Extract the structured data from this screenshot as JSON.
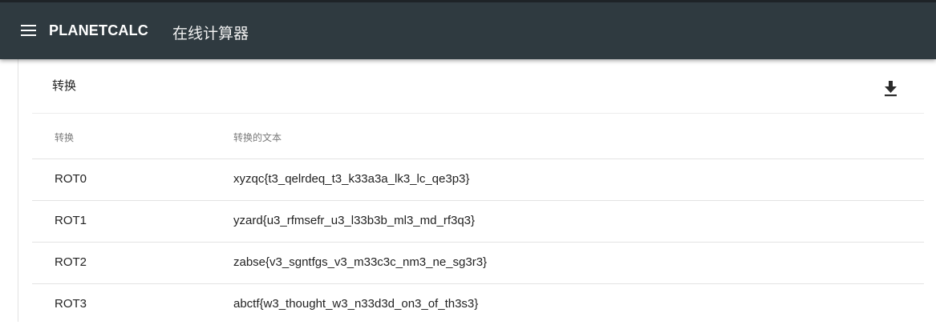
{
  "header": {
    "brand": "PLANETCALC",
    "subtitle": "在线计算器"
  },
  "card": {
    "title": "转换",
    "columns": {
      "transform": "转换",
      "transformed_text": "转换的文本"
    },
    "rows": [
      {
        "name": "ROT0",
        "text": "xyzqc{t3_qelrdeq_t3_k33a3a_lk3_lc_qe3p3}"
      },
      {
        "name": "ROT1",
        "text": "yzard{u3_rfmsefr_u3_l33b3b_ml3_md_rf3q3}"
      },
      {
        "name": "ROT2",
        "text": "zabse{v3_sgntfgs_v3_m33c3c_nm3_ne_sg3r3}"
      },
      {
        "name": "ROT3",
        "text": "abctf{w3_thought_w3_n33d3d_on3_of_th3s3}"
      }
    ]
  },
  "icons": {
    "menu": "hamburger-menu-icon",
    "download": "download-icon"
  },
  "colors": {
    "topbar": "#2f3a40",
    "text": "#222222",
    "muted": "#7a7a7a"
  }
}
